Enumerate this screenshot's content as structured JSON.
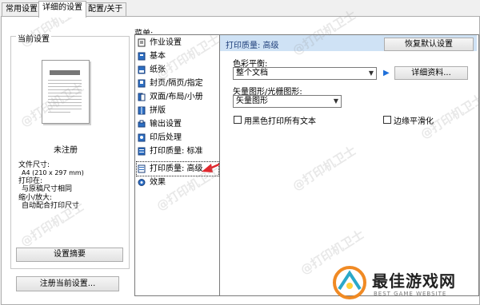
{
  "tabs": [
    {
      "label": "常用设置"
    },
    {
      "label": "详细的设置"
    },
    {
      "label": "配置/关于"
    }
  ],
  "current_settings": {
    "title": "当前设置",
    "name": "未注册",
    "paper_size_label": "文件尺寸:",
    "paper_size_value": "A4 (210 x 297 mm)",
    "print_on_label": "打印在:",
    "print_on_value": "与原稿尺寸相同",
    "scale_label": "缩小/放大:",
    "scale_value": "自动配合打印尺寸",
    "summary_button": "设置摘要",
    "register_button": "注册当前设置..."
  },
  "menu": {
    "label": "菜单:",
    "items": [
      {
        "label": "作业设置"
      },
      {
        "label": "基本"
      },
      {
        "label": "纸张"
      },
      {
        "label": "封页/隔页/指定"
      },
      {
        "label": "双面/布局/小册"
      },
      {
        "label": "拼版"
      },
      {
        "label": "输出设置"
      },
      {
        "label": "印后处理"
      },
      {
        "label": "打印质量: 标准"
      },
      {
        "label": "打印质量: 高级"
      },
      {
        "label": "效果"
      }
    ],
    "selected": "打印质量: 高级"
  },
  "panel": {
    "title": "打印质量: 高级",
    "restore_button": "恢复默认设置",
    "color_balance_label": "色彩平衡:",
    "color_balance_value": "整个文档",
    "details_button": "详细资料...",
    "vector_label": "矢量图形/光栅图形:",
    "vector_value": "矢量图形",
    "checkbox_black_text": "用黑色打印所有文本",
    "checkbox_edge_smoothing": "边缘平滑化"
  },
  "watermark": {
    "text": "@打印机卫士",
    "logo_text": "最佳游戏网",
    "logo_subtext": "BEST GAME WEBSITE"
  },
  "colors": {
    "accent": "#1e6fd9",
    "arrow": "#e0282e",
    "header_bg": "#cfe2f5"
  }
}
